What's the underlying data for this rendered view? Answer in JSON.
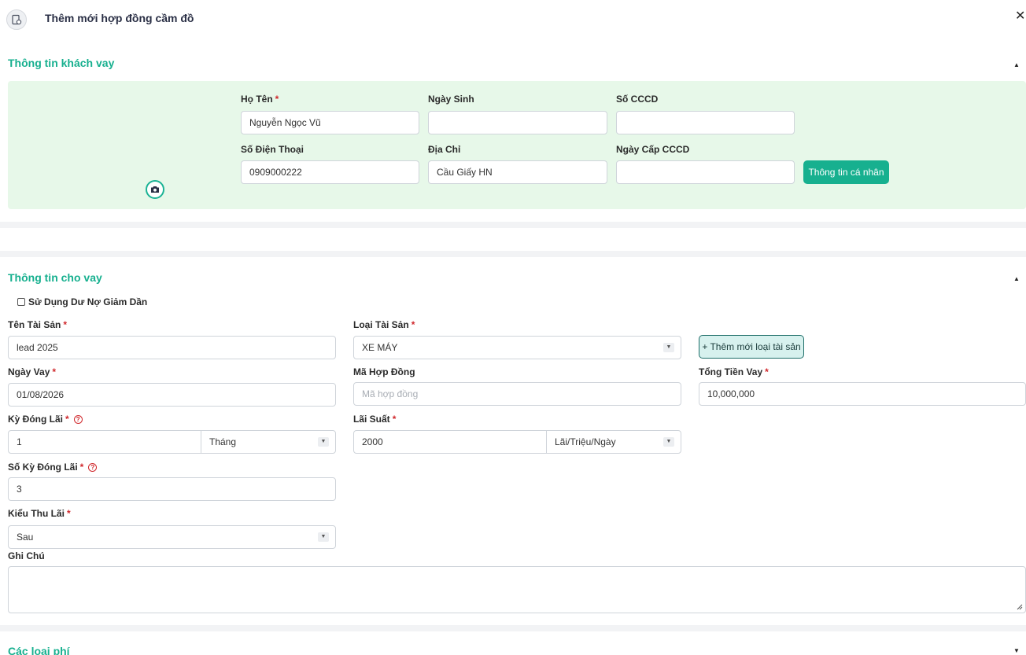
{
  "header": {
    "title": "Thêm mới hợp đồng cầm đồ",
    "close": "✕"
  },
  "customer": {
    "section_title": "Thông tin khách vay",
    "fields": {
      "name": {
        "label": "Họ Tên",
        "value": "Nguyễn Ngọc Vũ"
      },
      "dob": {
        "label": "Ngày Sinh",
        "value": ""
      },
      "cccd": {
        "label": "Số CCCD",
        "value": ""
      },
      "phone": {
        "label": "Số Điện Thoại",
        "value": "0909000222"
      },
      "address": {
        "label": "Địa Chỉ",
        "value": "Cầu Giấy HN"
      },
      "cccd_date": {
        "label": "Ngày Cấp CCCD",
        "value": ""
      }
    },
    "personal_info_button": "Thông tin cá nhân"
  },
  "loan": {
    "section_title": "Thông tin cho vay",
    "declining_balance_label": "Sử Dụng Dư Nợ Giảm Dần",
    "asset_name": {
      "label": "Tên Tài Sản",
      "value": "lead 2025"
    },
    "asset_type": {
      "label": "Loại Tài Sản",
      "value": "XE MÁY"
    },
    "add_asset_type_button": "+ Thêm mới loại tài sản",
    "loan_date": {
      "label": "Ngày Vay",
      "value": "01/08/2026"
    },
    "contract_code": {
      "label": "Mã Hợp Đồng",
      "placeholder": "Mã hợp đồng"
    },
    "total_amount": {
      "label": "Tổng Tiền Vay",
      "value": "10,000,000"
    },
    "interest_period": {
      "label": "Kỳ Đóng Lãi",
      "value": "1",
      "unit": "Tháng"
    },
    "interest_rate": {
      "label": "Lãi Suất",
      "value": "2000",
      "unit": "Lãi/Triệu/Ngày"
    },
    "num_periods": {
      "label": "Số Kỳ Đóng Lãi",
      "value": "3"
    },
    "collection_type": {
      "label": "Kiểu Thu Lãi",
      "value": "Sau"
    },
    "notes": {
      "label": "Ghi Chú",
      "value": ""
    }
  },
  "fees": {
    "section_title": "Các loại phí"
  },
  "common": {
    "required_mark": "*",
    "help_mark": "?",
    "caret_up": "▲",
    "caret_down": "▼"
  },
  "colors": {
    "accent": "#17b08f",
    "panel_bg": "#e7f8e9",
    "required": "#d0282c"
  }
}
